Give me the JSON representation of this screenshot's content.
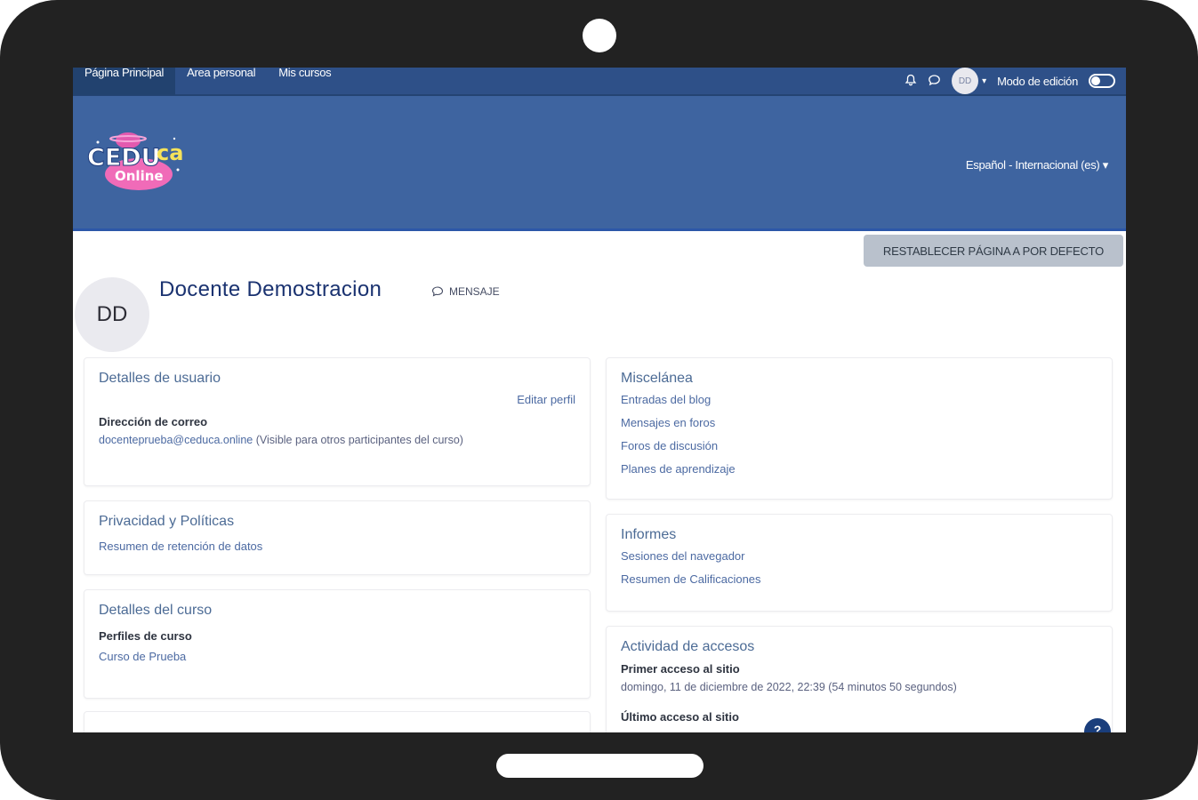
{
  "nav": {
    "items": [
      {
        "label": "Página Principal"
      },
      {
        "label": "Área personal"
      },
      {
        "label": "Mis cursos"
      }
    ],
    "avatar_initials": "DD",
    "edit_mode_label": "Modo de edición"
  },
  "header": {
    "logo_text_main": "CEDU",
    "logo_text_suffix": "ca",
    "logo_text_sub": "Online",
    "language": "Español - Internacional (es)"
  },
  "reset_button": "RESTABLECER PÁGINA A POR DEFECTO",
  "profile": {
    "initials": "DD",
    "name": "Docente Demostracion",
    "message_label": "MENSAJE"
  },
  "user_details": {
    "title": "Detalles de usuario",
    "edit_link": "Editar perfil",
    "email_label": "Dirección de correo",
    "email": "docenteprueba@ceduca.online",
    "email_note": "(Visible para otros participantes del curso)"
  },
  "privacy": {
    "title": "Privacidad y Políticas",
    "link": "Resumen de retención de datos"
  },
  "course_details": {
    "title": "Detalles del curso",
    "label": "Perfiles de curso",
    "link": "Curso de Prueba"
  },
  "misc": {
    "title": "Miscelánea",
    "links": [
      "Entradas del blog",
      "Mensajes en foros",
      "Foros de discusión",
      "Planes de aprendizaje"
    ]
  },
  "reports": {
    "title": "Informes",
    "links": [
      "Sesiones del navegador",
      "Resumen de Calificaciones"
    ]
  },
  "access": {
    "title": "Actividad de accesos",
    "first_label": "Primer acceso al sitio",
    "first_value": "domingo, 11 de diciembre de 2022, 22:39  (54 minutos 50 segundos)",
    "last_label": "Último acceso al sitio"
  },
  "help_glyph": "?"
}
